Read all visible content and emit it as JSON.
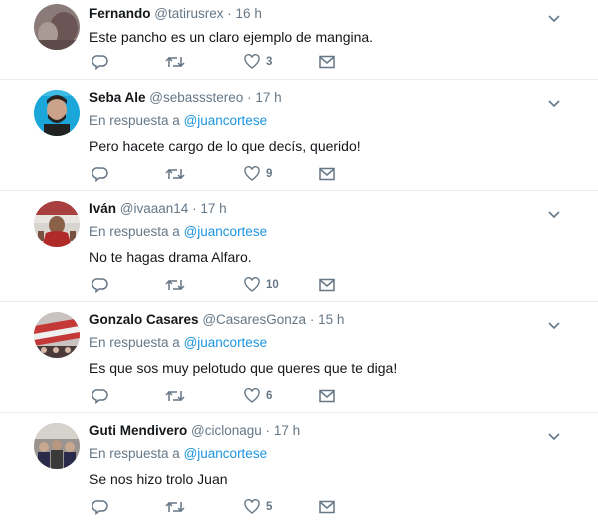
{
  "tweets": [
    {
      "fullname": "Fernando",
      "username": "@tatirusrex",
      "dot": "·",
      "time": "16 h",
      "reply_prefix": "",
      "reply_to": "",
      "text": "Este pancho es un claro ejemplo de mangina.",
      "likes": "3"
    },
    {
      "fullname": "Seba Ale",
      "username": "@sebassstereo",
      "dot": "·",
      "time": "17 h",
      "reply_prefix": "En respuesta a",
      "reply_to": "@juancortese",
      "text": "Pero hacete cargo de lo que decís, querido!",
      "likes": "9"
    },
    {
      "fullname": "Iván",
      "username": "@ivaaan14",
      "dot": "·",
      "time": "17 h",
      "reply_prefix": "En respuesta a",
      "reply_to": "@juancortese",
      "text": "No te hagas drama Alfaro.",
      "likes": "10"
    },
    {
      "fullname": "Gonzalo Casares",
      "username": "@CasaresGonza",
      "dot": "·",
      "time": "15 h",
      "reply_prefix": "En respuesta a",
      "reply_to": "@juancortese",
      "text": "Es que sos muy pelotudo que queres que te diga!",
      "likes": "6"
    },
    {
      "fullname": "Guti Mendivero",
      "username": "@ciclonagu",
      "dot": "·",
      "time": "17 h",
      "reply_prefix": "En respuesta a",
      "reply_to": "@juancortese",
      "text": "Se nos hizo trolo Juan",
      "likes": "5"
    }
  ],
  "icons": {
    "reply": "reply-icon",
    "retweet": "retweet-icon",
    "like": "heart-icon",
    "dm": "envelope-icon",
    "more": "chevron-down-icon"
  },
  "colors": {
    "link": "#1b95e0",
    "muted": "#657786",
    "border": "#e6ecf0"
  }
}
